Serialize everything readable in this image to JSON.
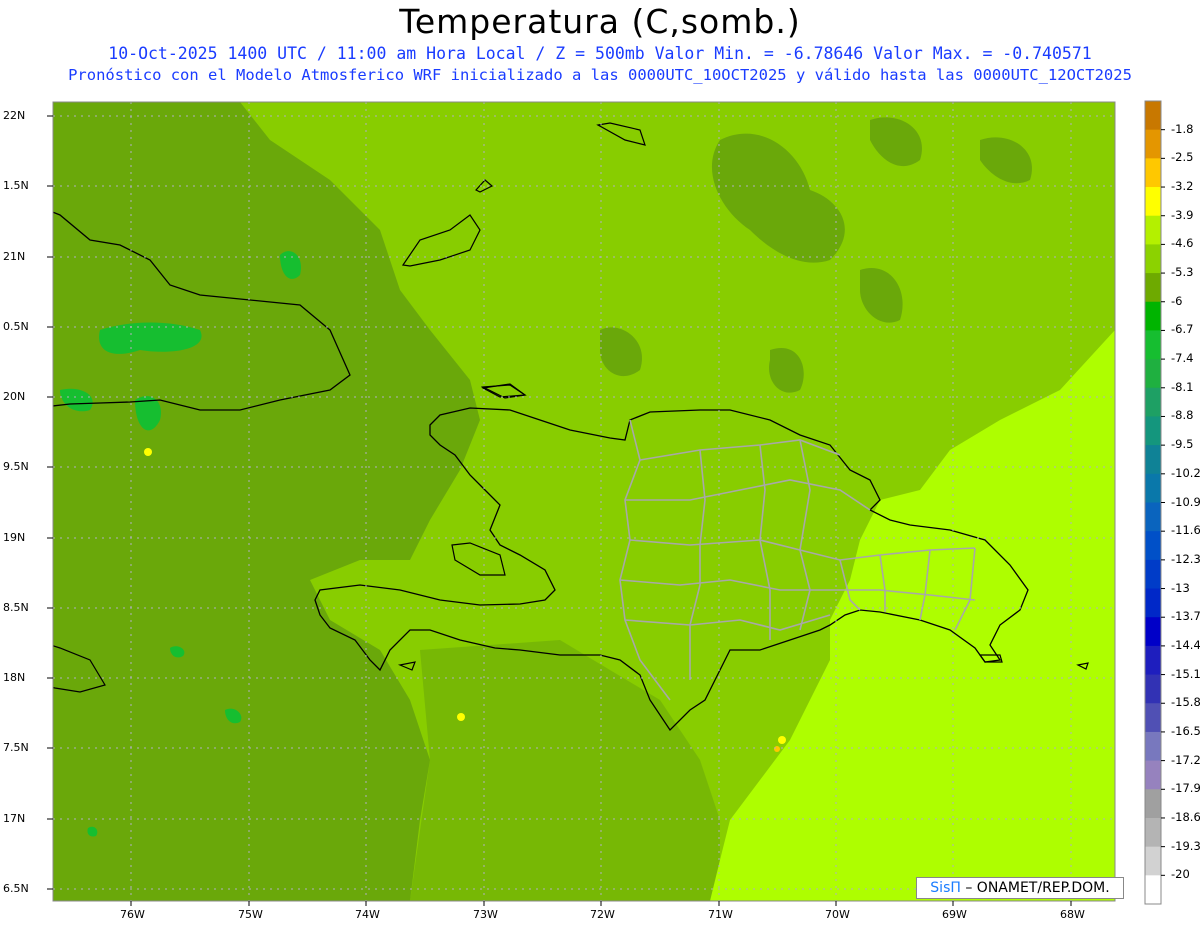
{
  "title": "Temperatura (C,somb.)",
  "subtitle_1": "10-Oct-2025  1400 UTC / 11:00 am Hora Local / Z = 500mb Valor Min. = -6.78646  Valor Max. = -0.740571",
  "subtitle_2": "Pronóstico con el Modelo Atmosferico WRF inicializado a las 0000UTC_10OCT2025 y válido hasta las  0000UTC_12OCT2025",
  "credit": {
    "brand": "SisΠ",
    "rest": " – ONAMET/REP.DOM."
  },
  "lat_labels": [
    "22N",
    "1.5N",
    "21N",
    "0.5N",
    "20N",
    "9.5N",
    "19N",
    "8.5N",
    "18N",
    "7.5N",
    "17N",
    "6.5N"
  ],
  "lon_labels": [
    "76W",
    "75W",
    "74W",
    "73W",
    "72W",
    "71W",
    "70W",
    "69W",
    "68W"
  ],
  "colorbar": {
    "labels": [
      "-1.8",
      "-2.5",
      "-3.2",
      "-3.9",
      "-4.6",
      "-5.3",
      "-6",
      "-6.7",
      "-7.4",
      "-8.1",
      "-8.8",
      "-9.5",
      "-10.2",
      "-10.9",
      "-11.6",
      "-12.3",
      "-13",
      "-13.7",
      "-14.4",
      "-15.1",
      "-15.8",
      "-16.5",
      "-17.2",
      "-17.9",
      "-18.6",
      "-19.3",
      "-20"
    ],
    "colors": [
      "#c87800",
      "#e49600",
      "#ffc800",
      "#ffff00",
      "#b4f000",
      "#8cd200",
      "#6eaa00",
      "#00b400",
      "#16be30",
      "#1fb040",
      "#1ea064",
      "#14967d",
      "#0f8296",
      "#0a78aa",
      "#0a64be",
      "#0050c8",
      "#003cc8",
      "#0028c8",
      "#0000c8",
      "#1e1ebe",
      "#3232b4",
      "#5050b4",
      "#7878be",
      "#9682be",
      "#a0a0a0",
      "#b4b4b4",
      "#d2d2d2",
      "#ffffff"
    ]
  },
  "field_colors": {
    "dark": "#6aa80a",
    "mid": "#88cd00",
    "light": "#aefe00",
    "warm": "#ffff00"
  }
}
